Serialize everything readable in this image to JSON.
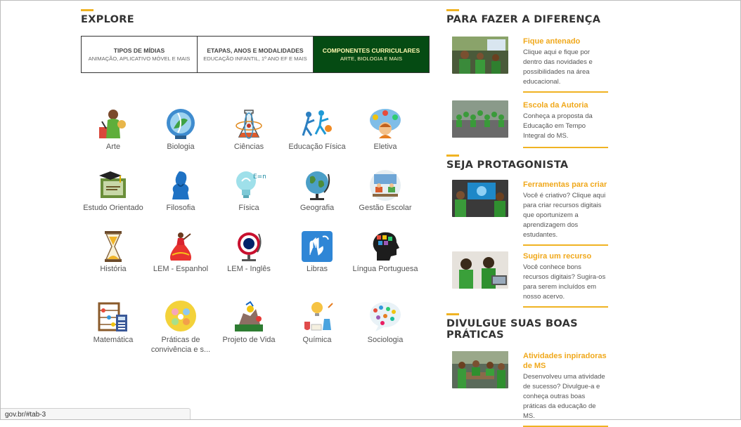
{
  "explore": {
    "title": "EXPLORE",
    "tabs": [
      {
        "title": "TIPOS DE MÍDIAS",
        "subtitle": "ANIMAÇÃO, APLICATIVO MÓVEL E MAIS"
      },
      {
        "title": "ETAPAS, ANOS E MODALIDADES",
        "subtitle": "EDUCAÇÃO INFANTIL, 1º ANO EF E MAIS"
      },
      {
        "title": "COMPONENTES CURRICULARES",
        "subtitle": "ARTE, BIOLOGIA E MAIS"
      }
    ],
    "subjects": [
      {
        "label": "Arte",
        "icon": "art-icon"
      },
      {
        "label": "Biologia",
        "icon": "biology-icon"
      },
      {
        "label": "Ciências",
        "icon": "science-icon"
      },
      {
        "label": "Educação Física",
        "icon": "physical-education-icon"
      },
      {
        "label": "Eletiva",
        "icon": "elective-icon"
      },
      {
        "label": "Estudo Orientado",
        "icon": "guided-study-icon"
      },
      {
        "label": "Filosofia",
        "icon": "philosophy-icon"
      },
      {
        "label": "Física",
        "icon": "physics-icon"
      },
      {
        "label": "Geografia",
        "icon": "geography-icon"
      },
      {
        "label": "Gestão Escolar",
        "icon": "school-management-icon"
      },
      {
        "label": "História",
        "icon": "history-icon"
      },
      {
        "label": "LEM - Espanhol",
        "icon": "spanish-icon"
      },
      {
        "label": "LEM - Inglês",
        "icon": "english-icon"
      },
      {
        "label": "Libras",
        "icon": "sign-language-icon"
      },
      {
        "label": "Língua Portuguesa",
        "icon": "portuguese-icon"
      },
      {
        "label": "Matemática",
        "icon": "math-icon"
      },
      {
        "label": "Práticas de convivência e s...",
        "icon": "coexistence-icon"
      },
      {
        "label": "Projeto de Vida",
        "icon": "life-project-icon"
      },
      {
        "label": "Química",
        "icon": "chemistry-icon"
      },
      {
        "label": "Sociologia",
        "icon": "sociology-icon"
      }
    ]
  },
  "diferenca": {
    "title": "PARA FAZER A DIFERENÇA",
    "cards": [
      {
        "title": "Fique antenado",
        "text": "Clique aqui e fique por dentro das novidades e possibilidades na área educacional."
      },
      {
        "title": "Escola da Autoria",
        "text": "Conheça a proposta da Educação em Tempo Integral do MS."
      }
    ]
  },
  "protagonista": {
    "title": "SEJA PROTAGONISTA",
    "cards": [
      {
        "title": "Ferramentas para criar",
        "text": "Você é criativo? Clique aqui para criar recursos digitais que oportunizem a aprendizagem dos estudantes."
      },
      {
        "title": "Sugira um recurso",
        "text": "Você conhece bons recursos digitais? Sugira-os para serem incluídos em nosso acervo."
      }
    ]
  },
  "boas_praticas": {
    "title": "DIVULGUE SUAS BOAS PRÁTICAS",
    "cards": [
      {
        "title": "Atividades inpiradoras de MS",
        "text": "Desenvolveu uma atividade de sucesso? Divulgue-a e conheça outras boas práticas da educação de MS."
      }
    ]
  },
  "status_url": "gov.br/#tab-3"
}
